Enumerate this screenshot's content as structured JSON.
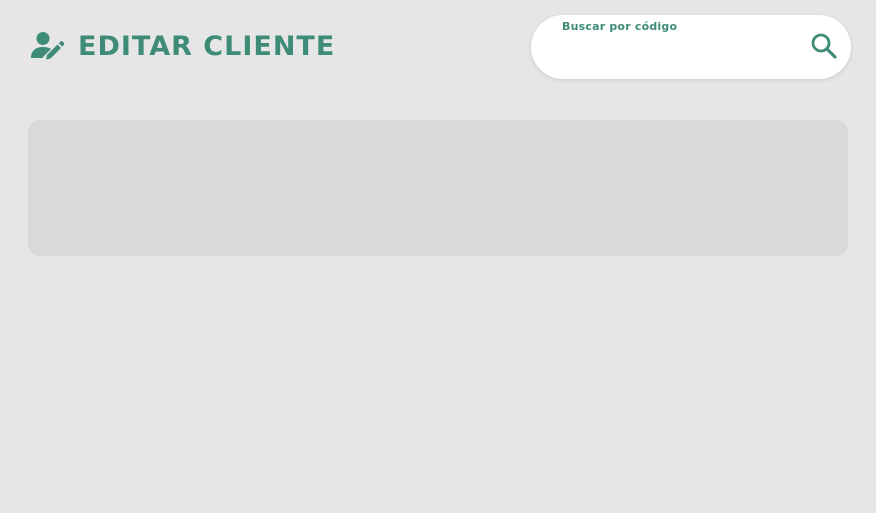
{
  "header": {
    "icon": "user-edit-icon",
    "title": "EDITAR CLIENTE"
  },
  "search": {
    "label": "Buscar por código",
    "value": "",
    "placeholder": "",
    "icon": "search-icon"
  },
  "colors": {
    "accent": "#3e8c78",
    "background": "#e6e6e6",
    "panel": "#d9d9d9",
    "search_bg": "#ffffff"
  }
}
